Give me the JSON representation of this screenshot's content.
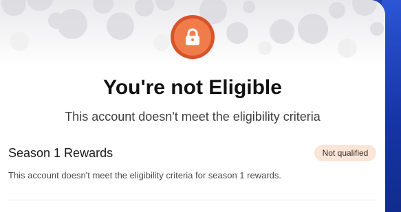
{
  "modal": {
    "title": "You're not Eligible",
    "subtitle": "This account doesn't meet the eligibility criteria",
    "icon": "lock-icon",
    "colors": {
      "badge_outer": "#d9532a",
      "badge_inner": "#f07c4b",
      "status_badge_bg": "#fbe4d8",
      "side_panel": "#1f3fa8"
    }
  },
  "season": {
    "title": "Season 1 Rewards",
    "status": "Not qualified",
    "description": "This account doesn't meet the eligibility criteria for season 1 rewards."
  }
}
